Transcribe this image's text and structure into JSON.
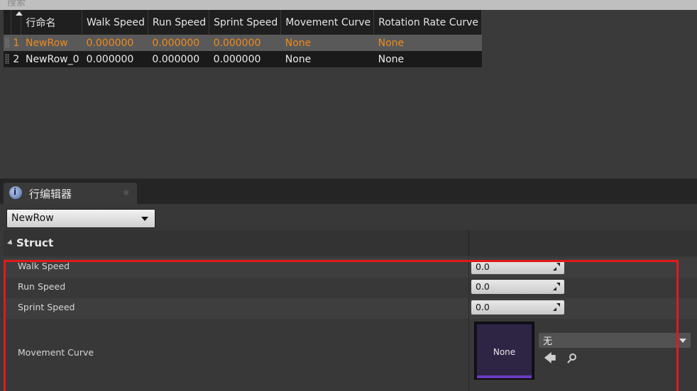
{
  "search": {
    "placeholder": "搜索"
  },
  "table": {
    "headers": [
      "行命名",
      "Walk Speed",
      "Run Speed",
      "Sprint Speed",
      "Movement Curve",
      "Rotation Rate Curve"
    ],
    "rows": [
      {
        "index": "1",
        "name": "NewRow",
        "walk": "0.000000",
        "run": "0.000000",
        "sprint": "0.000000",
        "movement": "None",
        "rotation": "None"
      },
      {
        "index": "2",
        "name": "NewRow_0",
        "walk": "0.000000",
        "run": "0.000000",
        "sprint": "0.000000",
        "movement": "None",
        "rotation": "None"
      }
    ]
  },
  "tab": {
    "label": "行编辑器"
  },
  "row_selector": {
    "value": "NewRow"
  },
  "struct": {
    "title": "Struct",
    "walk_label": "Walk Speed",
    "walk_value": "0.0",
    "run_label": "Run Speed",
    "run_value": "0.0",
    "sprint_label": "Sprint Speed",
    "sprint_value": "0.0",
    "movement_label": "Movement Curve",
    "thumbnail_text": "None",
    "asset_value": "无"
  },
  "colors": {
    "selected_text": "#f08a1c",
    "highlight": "#e01b1b",
    "asset_bar": "#6b3cc0"
  }
}
